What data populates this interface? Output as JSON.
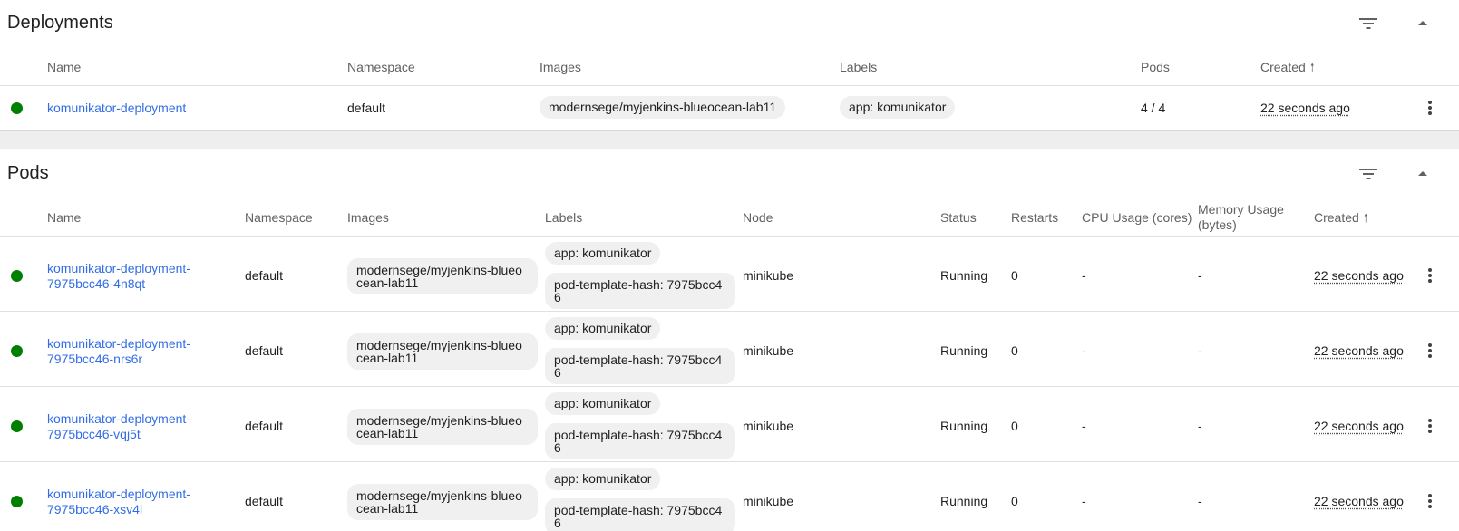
{
  "deployments": {
    "title": "Deployments",
    "columns": {
      "name": "Name",
      "namespace": "Namespace",
      "images": "Images",
      "labels": "Labels",
      "pods": "Pods",
      "created": "Created"
    },
    "rows": [
      {
        "name": "komunikator-deployment",
        "namespace": "default",
        "image": "modernsege/myjenkins-blueocean-lab11",
        "label": "app: komunikator",
        "pods": "4 / 4",
        "created": "22 seconds ago"
      }
    ]
  },
  "pods": {
    "title": "Pods",
    "columns": {
      "name": "Name",
      "namespace": "Namespace",
      "images": "Images",
      "labels": "Labels",
      "node": "Node",
      "status": "Status",
      "restarts": "Restarts",
      "cpu": "CPU Usage (cores)",
      "memory": "Memory Usage (bytes)",
      "created": "Created"
    },
    "rows": [
      {
        "name_line1": "komunikator-deployment-",
        "name_line2": "7975bcc46-4n8qt",
        "namespace": "default",
        "image_line1": "modernsege/myjenkins-blueo",
        "image_line2": "cean-lab11",
        "label1": "app: komunikator",
        "label2_line1": "pod-template-hash: 7975bcc4",
        "label2_line2": "6",
        "node": "minikube",
        "status": "Running",
        "restarts": "0",
        "cpu": "-",
        "memory": "-",
        "created": "22 seconds ago"
      },
      {
        "name_line1": "komunikator-deployment-",
        "name_line2": "7975bcc46-nrs6r",
        "namespace": "default",
        "image_line1": "modernsege/myjenkins-blueo",
        "image_line2": "cean-lab11",
        "label1": "app: komunikator",
        "label2_line1": "pod-template-hash: 7975bcc4",
        "label2_line2": "6",
        "node": "minikube",
        "status": "Running",
        "restarts": "0",
        "cpu": "-",
        "memory": "-",
        "created": "22 seconds ago"
      },
      {
        "name_line1": "komunikator-deployment-",
        "name_line2": "7975bcc46-vqj5t",
        "namespace": "default",
        "image_line1": "modernsege/myjenkins-blueo",
        "image_line2": "cean-lab11",
        "label1": "app: komunikator",
        "label2_line1": "pod-template-hash: 7975bcc4",
        "label2_line2": "6",
        "node": "minikube",
        "status": "Running",
        "restarts": "0",
        "cpu": "-",
        "memory": "-",
        "created": "22 seconds ago"
      },
      {
        "name_line1": "komunikator-deployment-",
        "name_line2": "7975bcc46-xsv4l",
        "namespace": "default",
        "image_line1": "modernsege/myjenkins-blueo",
        "image_line2": "cean-lab11",
        "label1": "app: komunikator",
        "label2_line1": "pod-template-hash: 7975bcc4",
        "label2_line2": "6",
        "node": "minikube",
        "status": "Running",
        "restarts": "0",
        "cpu": "-",
        "memory": "-",
        "created": "22 seconds ago"
      }
    ]
  },
  "colors": {
    "link": "#326de6",
    "status_ok": "#008000",
    "chip_bg": "#f0f0f0",
    "header_text": "#616161"
  },
  "icons": {
    "filter": "filter-icon",
    "collapse": "chevron-up-icon",
    "more": "more-vert-icon",
    "sort": "arrow-up-icon",
    "status": "status-success-icon"
  }
}
